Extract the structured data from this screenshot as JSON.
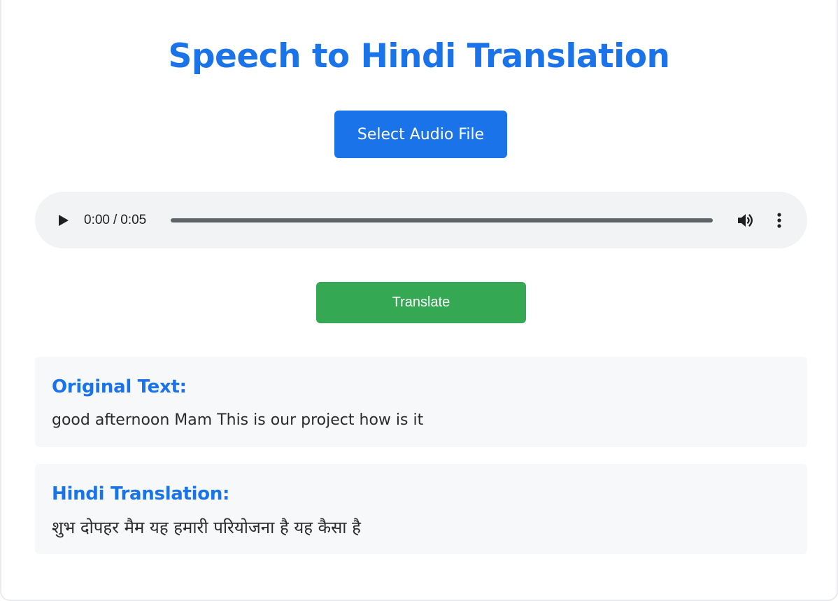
{
  "page": {
    "title": "Speech to Hindi Translation"
  },
  "file_picker": {
    "label": "Select Audio File"
  },
  "audio_player": {
    "current_time": "0:00",
    "separator": "/",
    "duration": "0:05",
    "progress": 0,
    "icons": [
      "play-icon",
      "volume-icon",
      "more-vert-icon"
    ]
  },
  "translate": {
    "label": "Translate"
  },
  "original": {
    "heading": "Original Text:",
    "text": "good afternoon Mam This is our project how is it"
  },
  "hindi": {
    "heading": "Hindi Translation:",
    "text": "शुभ दोपहर मैम यह हमारी परियोजना है यह कैसा है"
  },
  "colors": {
    "accent": "#1a73e8",
    "translate_button": "#34a853",
    "player_background": "#f1f3f4",
    "result_background": "#f7f8fa"
  }
}
